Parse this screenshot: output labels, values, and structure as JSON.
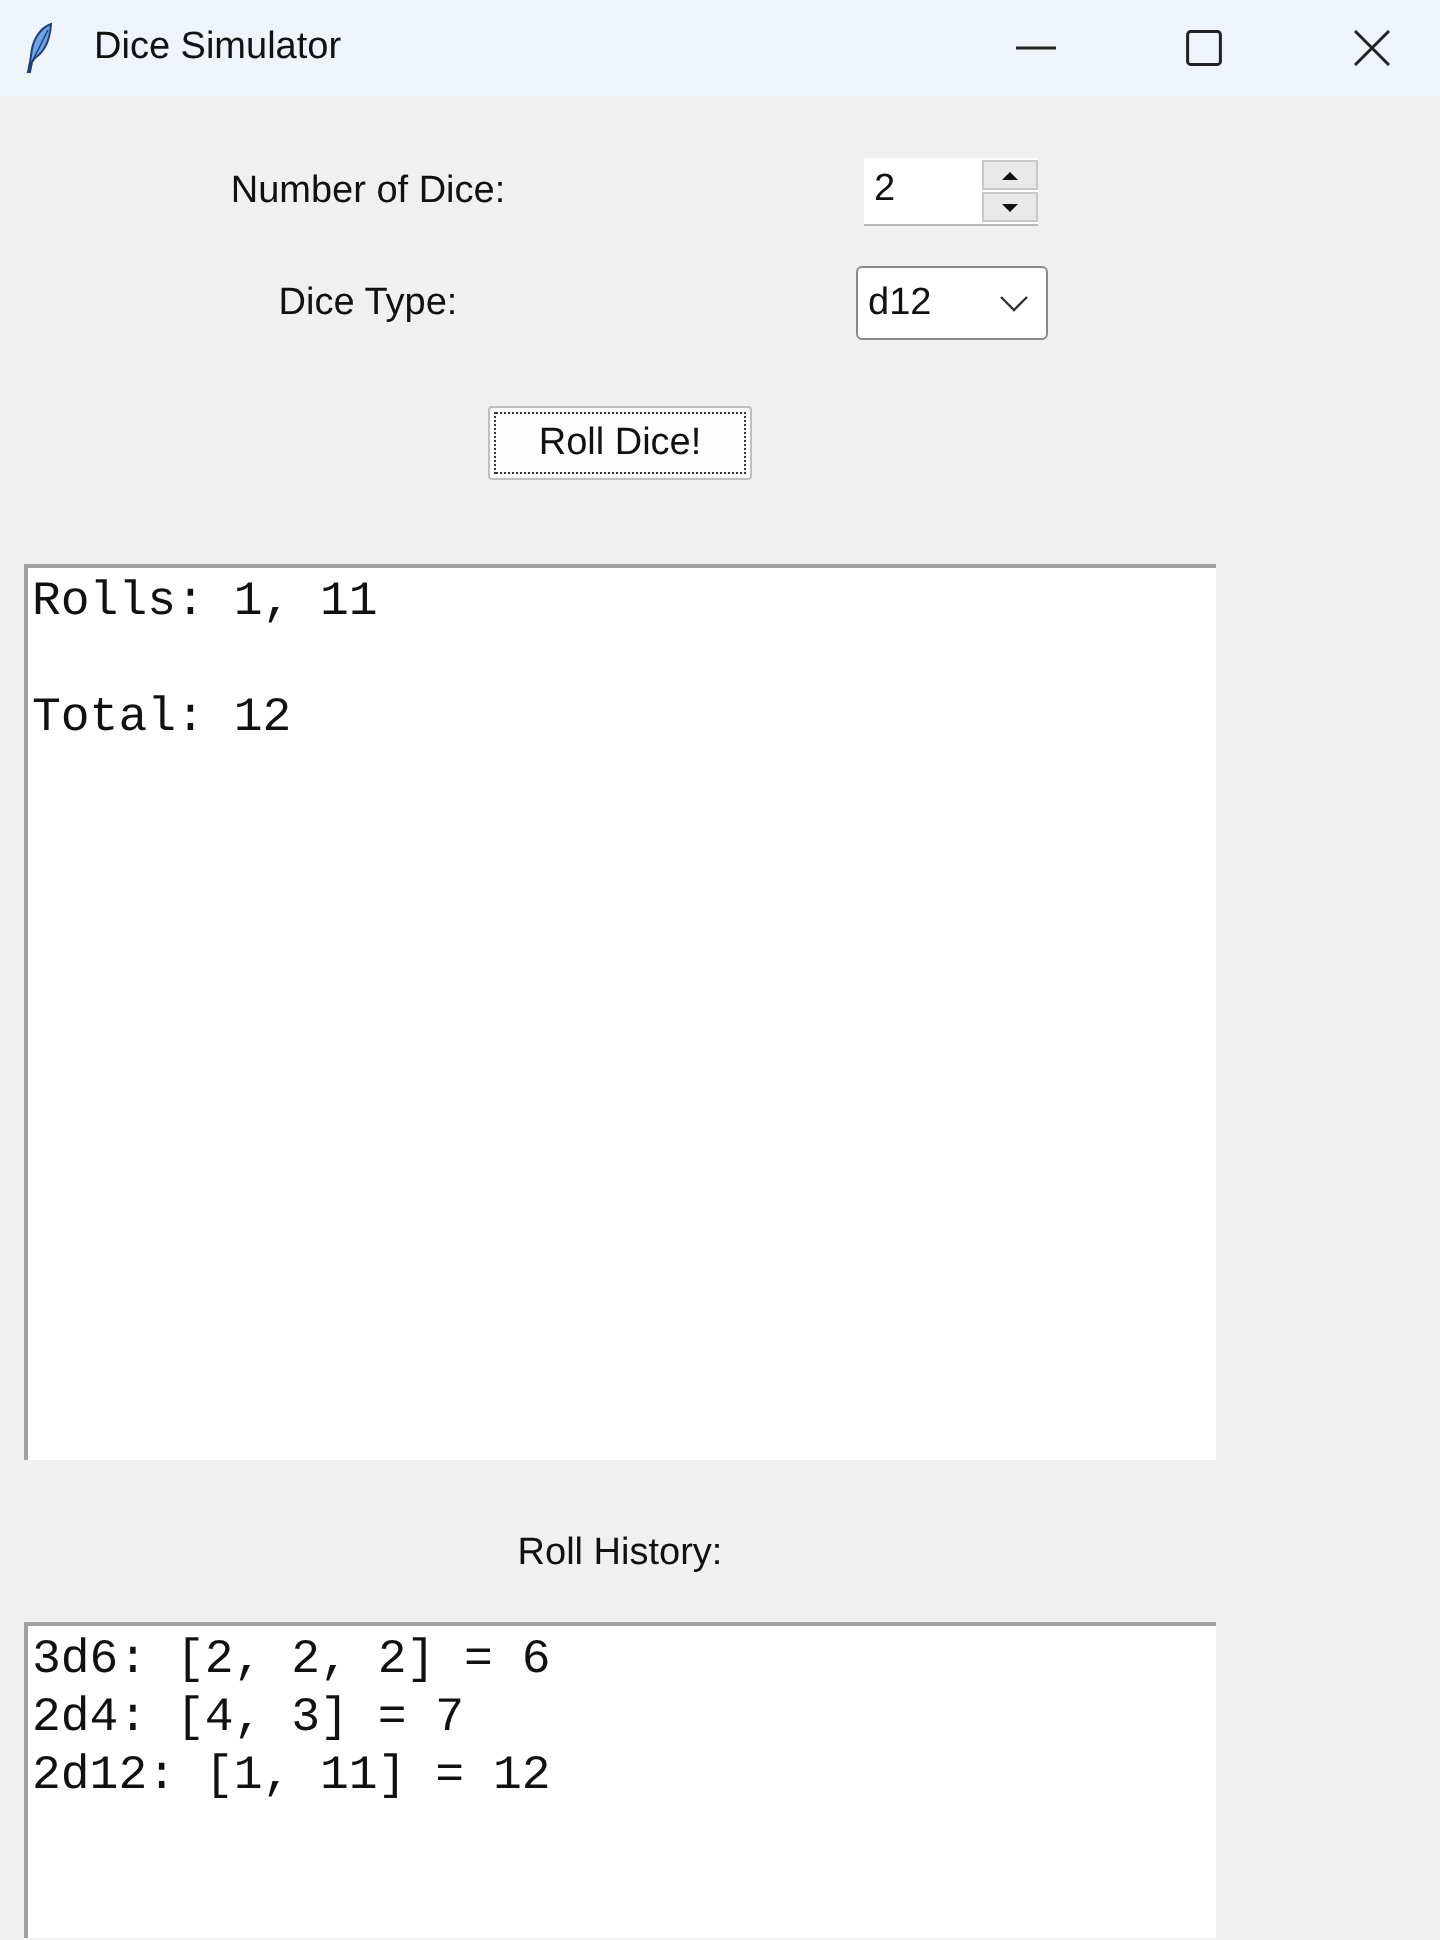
{
  "window": {
    "title": "Dice Simulator"
  },
  "dice_count": {
    "label": "Number of Dice:",
    "value": "2"
  },
  "dice_type": {
    "label": "Dice Type:",
    "value": "d12"
  },
  "roll_button": {
    "label": "Roll Dice!"
  },
  "result": {
    "rolls": "Rolls: 1, 11",
    "total": "Total: 12"
  },
  "history": {
    "label": "Roll History:",
    "entries": [
      "3d6: [2, 2, 2] = 6",
      "2d4: [4, 3] = 7",
      "2d12: [1, 11] = 12"
    ]
  }
}
